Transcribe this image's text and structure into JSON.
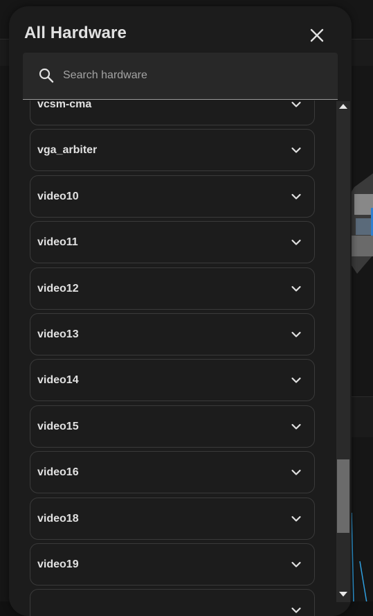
{
  "dialog": {
    "title": "All Hardware",
    "close_icon": "close-icon"
  },
  "search": {
    "placeholder": "Search hardware",
    "value": "",
    "icon": "search-icon"
  },
  "hardware_list": {
    "items": [
      {
        "label": "vcsm-cma"
      },
      {
        "label": "vga_arbiter"
      },
      {
        "label": "video10"
      },
      {
        "label": "video11"
      },
      {
        "label": "video12"
      },
      {
        "label": "video13"
      },
      {
        "label": "video14"
      },
      {
        "label": "video15"
      },
      {
        "label": "video16"
      },
      {
        "label": "video18"
      },
      {
        "label": "video19"
      },
      {
        "label": ""
      }
    ],
    "expand_icon": "chevron-down-icon"
  },
  "colors": {
    "dialog_bg": "#1c1c1c",
    "text_primary": "#e1e1e1",
    "item_border": "#3a3a3a",
    "search_bg": "#282828",
    "placeholder": "#a3a3a3"
  }
}
